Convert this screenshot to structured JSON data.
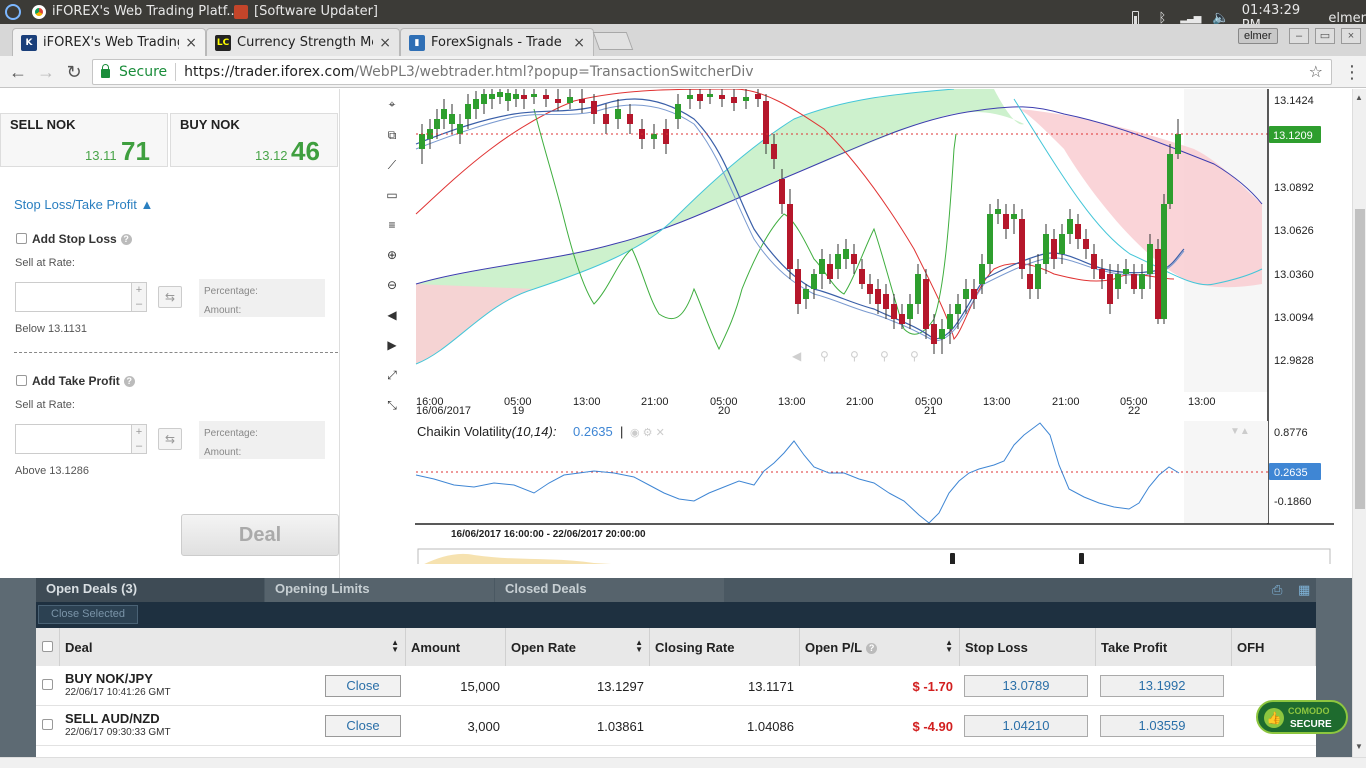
{
  "os": {
    "task1": "iFOREX's Web Trading Platf...",
    "task2": "[Software Updater]",
    "clock": "01:43:29 PM",
    "user": "elmer"
  },
  "tabs": [
    {
      "title": "iFOREX's Web Trading I",
      "close": "×"
    },
    {
      "title": "Currency Strength Met",
      "close": "×"
    },
    {
      "title": "ForexSignals - Trade Re",
      "close": "×"
    }
  ],
  "browser": {
    "user_chip": "elmer",
    "secure": "Secure",
    "url_host": "https://trader.iforex.com",
    "url_path": "/WebPL3/webtrader.html?popup=TransactionSwitcherDiv"
  },
  "trade": {
    "sell": {
      "label": "SELL NOK",
      "small": "13.11",
      "big": "71"
    },
    "buy": {
      "label": "BUY NOK",
      "small": "13.12",
      "big": "46"
    },
    "sltp_link": "Stop Loss/Take Profit ▲",
    "stop_loss": {
      "label": "Add Stop Loss",
      "rate_label": "Sell at Rate:",
      "pct": "Percentage:",
      "amt": "Amount:",
      "hint": "Below 13.1131"
    },
    "take_profit": {
      "label": "Add Take Profit",
      "rate_label": "Sell at Rate:",
      "pct": "Percentage:",
      "amt": "Amount:",
      "hint": "Above 13.1286"
    },
    "deal_btn": "Deal"
  },
  "chart": {
    "price_labels": [
      "13.1424",
      "13.0892",
      "13.0626",
      "13.0360",
      "13.0094",
      "12.9828"
    ],
    "current_price": "13.1209",
    "time_labels": [
      "16:00",
      "05:00",
      "13:00",
      "21:00",
      "05:00",
      "13:00",
      "21:00",
      "05:00",
      "13:00",
      "21:00",
      "05:00",
      "13:00"
    ],
    "date_labels": [
      "16/06/2017",
      "19",
      "20",
      "21",
      "22"
    ],
    "indicator_name": "Chaikin Volatility",
    "indicator_params": "(10,14):",
    "indicator_value": "0.2635",
    "indicator_labels": [
      "0.8776",
      "-0.1860"
    ],
    "range_label": "16/06/2017 16:00:00 - 22/06/2017 20:00:00",
    "colors": {
      "up": "#2e9e2e",
      "down": "#b5172b",
      "cloud_up": "#c8f0c8",
      "cloud_down": "#f9cfd4",
      "chaikin": "#3f86d4"
    }
  },
  "deals": {
    "tabs": [
      "Open Deals (3)",
      "Opening Limits",
      "Closed Deals"
    ],
    "close_selected": "Close Selected",
    "headers": [
      "Deal",
      "Amount",
      "Open Rate",
      "Closing Rate",
      "Open P/L",
      "Stop Loss",
      "Take Profit",
      "OFH"
    ],
    "rows": [
      {
        "name": "BUY NOK/JPY",
        "time": "22/06/17 10:41:26 GMT",
        "close": "Close",
        "amount": "15,000",
        "open_rate": "13.1297",
        "closing_rate": "13.1171",
        "pl": "$ -1.70",
        "sl": "13.0789",
        "tp": "13.1992"
      },
      {
        "name": "SELL AUD/NZD",
        "time": "22/06/17 09:30:33 GMT",
        "close": "Close",
        "amount": "3,000",
        "open_rate": "1.03861",
        "closing_rate": "1.04086",
        "pl": "$ -4.90",
        "sl": "1.04210",
        "tp": "1.03559"
      }
    ]
  },
  "badge": {
    "line1": "COMODO",
    "line2": "SECURE"
  }
}
